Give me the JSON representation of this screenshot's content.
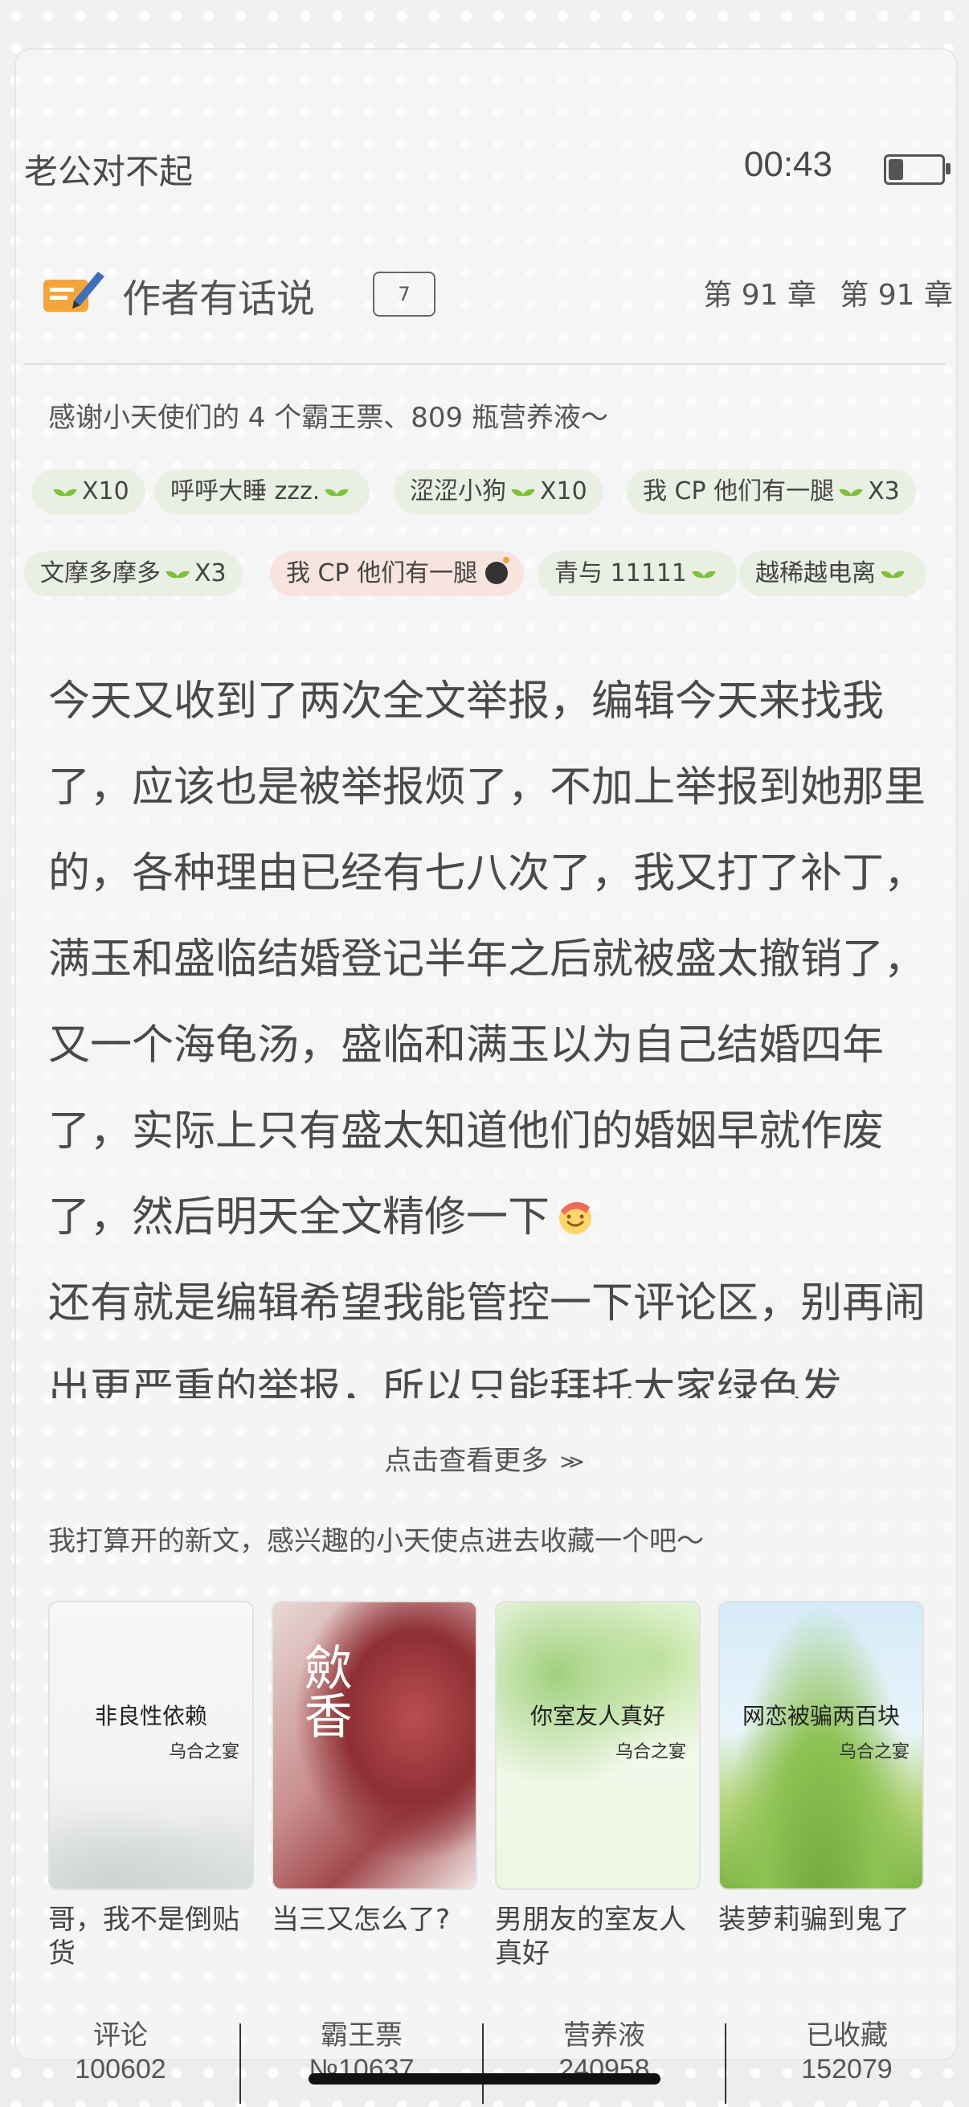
{
  "status_bar": {
    "title": "老公对不起",
    "time": "00:43"
  },
  "author_note": {
    "title": "作者有话说",
    "comment_count": "7",
    "chapter_a": "第 91 章",
    "chapter_b": "第 91 章",
    "thanks": "感谢小天使们的 4 个霸王票、809 瓶营养液～"
  },
  "chips_row1": [
    "X10",
    "呼呼大睡 zzz.",
    "涩涩小狗",
    "X10",
    "我 CP 他们有一腿",
    "X3"
  ],
  "chips_row2": [
    "文摩多摩多",
    "X3",
    "我 CP 他们有一腿",
    "青与 11111",
    "越稀越电离"
  ],
  "article": {
    "p1": "今天又收到了两次全文举报，编辑今天来找我了，应该也是被举报烦了，不加上举报到她那里的，各种理由已经有七八次了，我又打了补丁，满玉和盛临结婚登记半年之后就被盛太撤销了，又一个海龟汤，盛临和满玉以为自己结婚四年了，实际上只有盛太知道他们的婚姻早就作废了，然后明天全文精修一下",
    "p2": "还有就是编辑希望我能管控一下评论区，别再闹出更严重的举报，所以只能拜托大家绿色发",
    "see_more": "点击查看更多"
  },
  "new_books": {
    "title": "我打算开的新文，感兴趣的小天使点进去收藏一个吧～",
    "books": [
      {
        "cover_title": "非良性依赖",
        "cover_author": "乌合之宴",
        "name": "哥，我不是倒贴货"
      },
      {
        "cover_title": "歛香",
        "cover_author": "",
        "name": "当三又怎么了?"
      },
      {
        "cover_title": "你室友人真好",
        "cover_author": "乌合之宴",
        "name": "男朋友的室友人真好"
      },
      {
        "cover_title": "网恋被骗两百块",
        "cover_author": "乌合之宴",
        "name": "装萝莉骗到鬼了"
      }
    ]
  },
  "bottom_bar": {
    "comments_label": "评论",
    "comments_value": "100602",
    "tickets_label": "霸王票",
    "tickets_value": "№10637",
    "nutrients_label": "营养液",
    "nutrients_value": "240958",
    "favorites_label": "已收藏",
    "favorites_value": "152079"
  }
}
